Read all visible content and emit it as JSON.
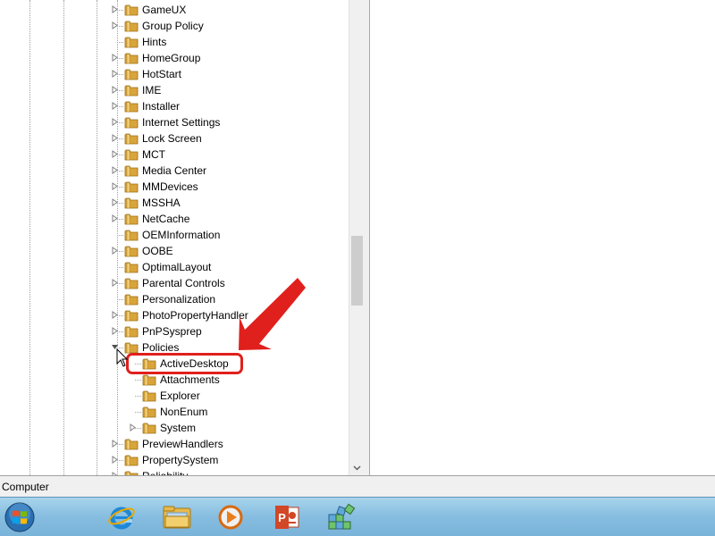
{
  "tree": {
    "items": [
      {
        "label": "GameUX",
        "expander": true
      },
      {
        "label": "Group Policy",
        "expander": true
      },
      {
        "label": "Hints",
        "expander": false
      },
      {
        "label": "HomeGroup",
        "expander": true
      },
      {
        "label": "HotStart",
        "expander": true
      },
      {
        "label": "IME",
        "expander": true
      },
      {
        "label": "Installer",
        "expander": true
      },
      {
        "label": "Internet Settings",
        "expander": true
      },
      {
        "label": "Lock Screen",
        "expander": true
      },
      {
        "label": "MCT",
        "expander": true
      },
      {
        "label": "Media Center",
        "expander": true
      },
      {
        "label": "MMDevices",
        "expander": true
      },
      {
        "label": "MSSHA",
        "expander": true
      },
      {
        "label": "NetCache",
        "expander": true
      },
      {
        "label": "OEMInformation",
        "expander": false
      },
      {
        "label": "OOBE",
        "expander": true
      },
      {
        "label": "OptimalLayout",
        "expander": false
      },
      {
        "label": "Parental Controls",
        "expander": true
      },
      {
        "label": "Personalization",
        "expander": false
      },
      {
        "label": "PhotoPropertyHandler",
        "expander": true
      },
      {
        "label": "PnPSysprep",
        "expander": true
      },
      {
        "label": "Policies",
        "expander": true,
        "expanded": true
      },
      {
        "label": "ActiveDesktop",
        "expander": false,
        "child": true,
        "selected": true
      },
      {
        "label": "Attachments",
        "expander": false,
        "child": true
      },
      {
        "label": "Explorer",
        "expander": false,
        "child": true
      },
      {
        "label": "NonEnum",
        "expander": false,
        "child": true
      },
      {
        "label": "System",
        "expander": true,
        "child": true
      },
      {
        "label": "PreviewHandlers",
        "expander": true
      },
      {
        "label": "PropertySystem",
        "expander": true
      },
      {
        "label": "Reliability",
        "expander": true
      }
    ]
  },
  "statusbar": {
    "text": "Computer"
  },
  "taskbar": {
    "start_icon": "windows-start-orb",
    "pinned": [
      "internet-explorer-icon",
      "file-explorer-icon",
      "media-player-icon",
      "powerpoint-icon",
      "registry-editor-icon"
    ]
  },
  "annotation": {
    "color": "#e0201c",
    "target": "ActiveDesktop"
  }
}
